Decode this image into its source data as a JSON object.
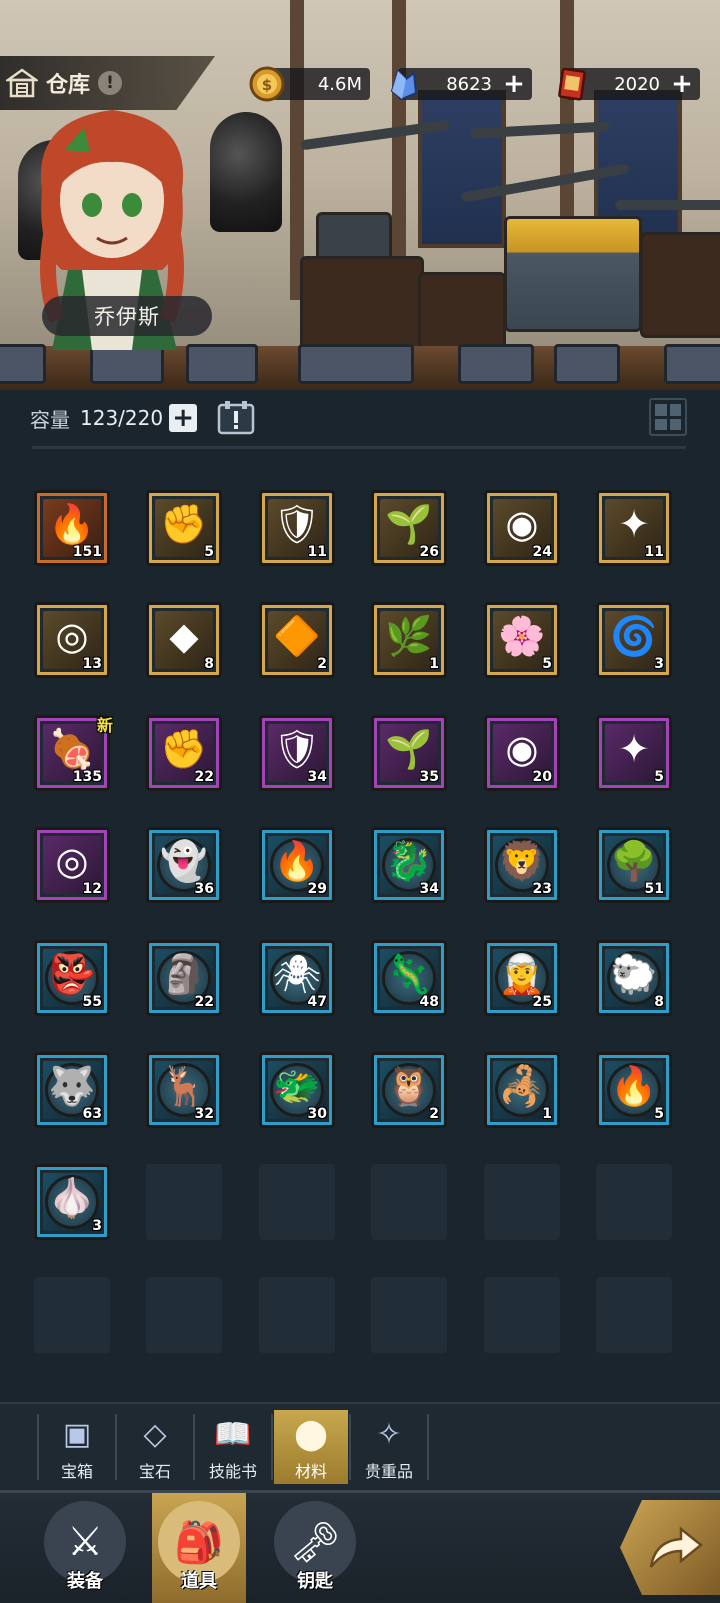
{
  "hero": {
    "name": "乔伊斯"
  },
  "header": {
    "title": "仓库",
    "info_icon": "exclamation-icon",
    "resources": [
      {
        "name": "coin",
        "value": "4.6M",
        "icon": "gold-coin-icon",
        "has_plus": false
      },
      {
        "name": "crystal",
        "value": "8623",
        "icon": "blue-crystal-icon",
        "has_plus": true
      },
      {
        "name": "ticket",
        "value": "2020",
        "icon": "red-ticket-icon",
        "has_plus": true
      }
    ]
  },
  "capacity": {
    "label": "容量",
    "value": "123/220"
  },
  "items": [
    {
      "frame": "orange",
      "glyph": "🔥",
      "qty": "151",
      "icon": "fire-essence-icon"
    },
    {
      "frame": "gold",
      "glyph": "✊",
      "qty": "5",
      "icon": "red-fist-icon"
    },
    {
      "frame": "gold",
      "glyph": "🛡",
      "qty": "11",
      "icon": "blue-shield-icon"
    },
    {
      "frame": "gold",
      "glyph": "🌱",
      "qty": "26",
      "icon": "green-sprout-icon"
    },
    {
      "frame": "gold",
      "glyph": "◉",
      "qty": "24",
      "icon": "purple-orb-icon"
    },
    {
      "frame": "gold",
      "glyph": "✦",
      "qty": "11",
      "icon": "golden-star-icon"
    },
    {
      "frame": "gold",
      "glyph": "◎",
      "qty": "13",
      "icon": "purple-ring-icon"
    },
    {
      "frame": "gold",
      "glyph": "◆",
      "qty": "8",
      "icon": "green-gem-icon"
    },
    {
      "frame": "gold",
      "glyph": "🔶",
      "qty": "2",
      "icon": "amber-crystal-icon"
    },
    {
      "frame": "gold",
      "glyph": "🌿",
      "qty": "1",
      "icon": "leaf-root-icon"
    },
    {
      "frame": "gold",
      "glyph": "🌸",
      "qty": "5",
      "icon": "pink-lotus-icon"
    },
    {
      "frame": "gold",
      "glyph": "🌀",
      "qty": "3",
      "icon": "amber-swirl-icon"
    },
    {
      "frame": "purple",
      "glyph": "🍖",
      "qty": "135",
      "icon": "meat-icon",
      "new": "新"
    },
    {
      "frame": "purple",
      "glyph": "✊",
      "qty": "22",
      "icon": "red-fist-icon"
    },
    {
      "frame": "purple",
      "glyph": "🛡",
      "qty": "34",
      "icon": "blue-shield-icon"
    },
    {
      "frame": "purple",
      "glyph": "🌱",
      "qty": "35",
      "icon": "green-sprout-icon"
    },
    {
      "frame": "purple",
      "glyph": "◉",
      "qty": "20",
      "icon": "purple-orb-icon"
    },
    {
      "frame": "purple",
      "glyph": "✦",
      "qty": "5",
      "icon": "golden-star-icon"
    },
    {
      "frame": "purple",
      "glyph": "◎",
      "qty": "12",
      "icon": "purple-ring-icon"
    },
    {
      "frame": "blue",
      "glyph": "👻",
      "qty": "36",
      "icon": "ghost-portrait-icon",
      "round": true
    },
    {
      "frame": "blue",
      "glyph": "🔥",
      "qty": "29",
      "icon": "fire-beast-portrait-icon",
      "round": true
    },
    {
      "frame": "blue",
      "glyph": "🐉",
      "qty": "34",
      "icon": "ice-dragon-portrait-icon",
      "round": true
    },
    {
      "frame": "blue",
      "glyph": "🦁",
      "qty": "23",
      "icon": "beast-portrait-icon",
      "round": true
    },
    {
      "frame": "blue",
      "glyph": "🌳",
      "qty": "51",
      "icon": "treant-portrait-icon",
      "round": true
    },
    {
      "frame": "blue",
      "glyph": "👺",
      "qty": "55",
      "icon": "green-demon-portrait-icon",
      "round": true
    },
    {
      "frame": "blue",
      "glyph": "🗿",
      "qty": "22",
      "icon": "golem-portrait-icon",
      "round": true
    },
    {
      "frame": "blue",
      "glyph": "🕷",
      "qty": "47",
      "icon": "spider-portrait-icon",
      "round": true
    },
    {
      "frame": "blue",
      "glyph": "🦎",
      "qty": "48",
      "icon": "lizard-portrait-icon",
      "round": true
    },
    {
      "frame": "blue",
      "glyph": "🧝",
      "qty": "25",
      "icon": "elf-portrait-icon",
      "round": true
    },
    {
      "frame": "blue",
      "glyph": "🐑",
      "qty": "8",
      "icon": "white-spirit-portrait-icon",
      "round": true
    },
    {
      "frame": "blue",
      "glyph": "🐺",
      "qty": "63",
      "icon": "shadow-wolf-portrait-icon",
      "round": true
    },
    {
      "frame": "blue",
      "glyph": "🦌",
      "qty": "32",
      "icon": "deer-portrait-icon",
      "round": true
    },
    {
      "frame": "blue",
      "glyph": "🐲",
      "qty": "30",
      "icon": "sea-dragon-portrait-icon",
      "round": true
    },
    {
      "frame": "blue",
      "glyph": "🦉",
      "qty": "2",
      "icon": "owl-portrait-icon",
      "round": true
    },
    {
      "frame": "blue",
      "glyph": "🦂",
      "qty": "1",
      "icon": "mantis-portrait-icon",
      "round": true
    },
    {
      "frame": "blue",
      "glyph": "🔥",
      "qty": "5",
      "icon": "flame-spirit-portrait-icon",
      "round": true
    },
    {
      "frame": "blue",
      "glyph": "🧄",
      "qty": "3",
      "icon": "garlic-portrait-icon",
      "round": true
    }
  ],
  "empty_slots": 11,
  "categories": [
    {
      "label": "宝箱",
      "icon": "chest-icon",
      "glyph": "▣",
      "active": false
    },
    {
      "label": "宝石",
      "icon": "gem-icon",
      "glyph": "◇",
      "active": false
    },
    {
      "label": "技能书",
      "icon": "book-icon",
      "glyph": "📖",
      "active": false
    },
    {
      "label": "材料",
      "icon": "material-icon",
      "glyph": "⬤",
      "active": true
    },
    {
      "label": "贵重品",
      "icon": "valuable-icon",
      "glyph": "✧",
      "active": false
    }
  ],
  "nav": [
    {
      "label": "装备",
      "icon": "sword-icon",
      "glyph": "⚔",
      "active": false
    },
    {
      "label": "道具",
      "icon": "backpack-icon",
      "glyph": "🎒",
      "active": true
    },
    {
      "label": "钥匙",
      "icon": "key-icon",
      "glyph": "🗝",
      "active": false
    }
  ],
  "colors": {
    "background": "#1b252d",
    "frame_orange": "#c96c2a",
    "frame_gold": "#d3a74a",
    "frame_purple": "#a443b9",
    "frame_blue": "#2c9ec8",
    "accent_gold": "#c8a84d"
  }
}
